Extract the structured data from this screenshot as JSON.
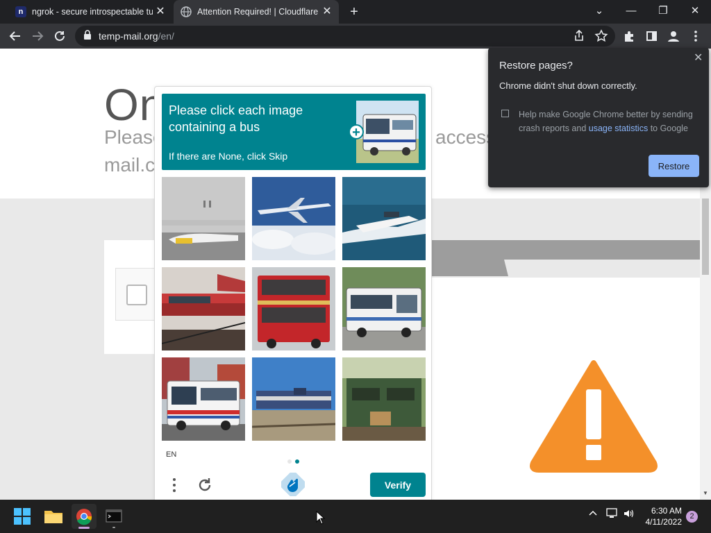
{
  "browser": {
    "tabs": [
      {
        "title": "ngrok - secure introspectable tunnels",
        "favicon": "ngrok-icon",
        "close": "✕"
      },
      {
        "title": "Attention Required! | Cloudflare",
        "favicon": "globe-icon",
        "close": "✕"
      }
    ],
    "new_tab": "+",
    "window_controls": {
      "tabsearch": "⌄",
      "minimize": "—",
      "restore": "❐",
      "close": "✕"
    },
    "url_host": "temp-mail.org",
    "url_path": "/en/"
  },
  "page": {
    "title": "On",
    "subtitle_left": "Please",
    "subtitle_right": "access",
    "subtitle_line2": "mail.c"
  },
  "captcha": {
    "prompt": "Please click each image containing a bus",
    "hint": "If there are None, click Skip",
    "plus": "+",
    "language": "EN",
    "verify_label": "Verify",
    "accent_color": "#00838f",
    "tiles": [
      {
        "subject": "airplane"
      },
      {
        "subject": "airplane"
      },
      {
        "subject": "boat"
      },
      {
        "subject": "train"
      },
      {
        "subject": "bus"
      },
      {
        "subject": "bus"
      },
      {
        "subject": "bus"
      },
      {
        "subject": "train"
      },
      {
        "subject": "train"
      }
    ],
    "pages": 2,
    "current_page": 2
  },
  "restore_popup": {
    "title": "Restore pages?",
    "message": "Chrome didn't shut down correctly.",
    "option_before": "Help make Google Chrome better by sending crash reports and ",
    "option_link": "usage statistics",
    "option_after": " to Google",
    "restore_label": "Restore",
    "close": "✕"
  },
  "taskbar": {
    "time": "6:30 AM",
    "date": "4/11/2022",
    "notifications": "2"
  }
}
